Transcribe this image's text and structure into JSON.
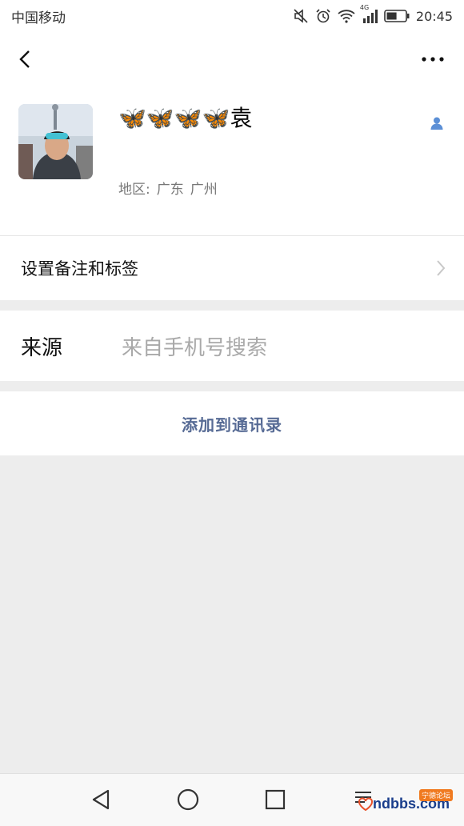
{
  "status_bar": {
    "carrier": "中国移动",
    "network": "4G",
    "time": "20:45",
    "battery_level": 0.55
  },
  "header": {
    "back_icon": "chevron-left-icon",
    "more_icon": "more-horizontal-icon"
  },
  "profile": {
    "nickname": "🦋🦋🦋🦋袁",
    "region_label": "地区:",
    "region_province": "广东",
    "region_city": "广州",
    "contact_icon": "person-icon"
  },
  "menu": {
    "remark_label": "设置备注和标签",
    "source_label": "来源",
    "source_value": "来自手机号搜索",
    "add_contact_label": "添加到通讯录"
  },
  "navbar": {
    "back": "triangle-back-icon",
    "home": "circle-home-icon",
    "recent": "square-recent-icon"
  },
  "watermark": {
    "text": "ndbbs.com",
    "badge": "宁德论坛"
  },
  "colors": {
    "link_blue": "#576b95",
    "contact_icon_blue": "#5b8fd6",
    "background": "#ededed"
  }
}
